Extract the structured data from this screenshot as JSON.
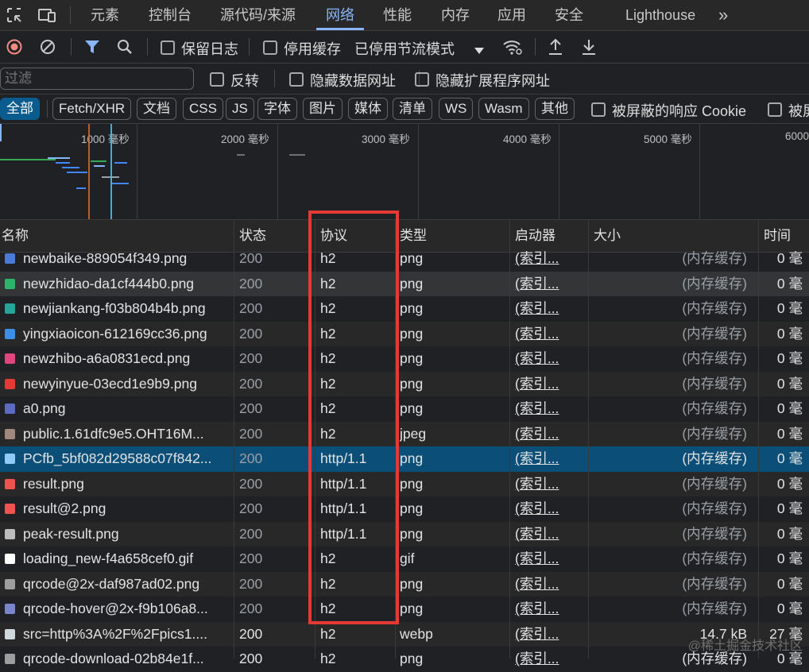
{
  "tabs": [
    "元素",
    "控制台",
    "源代码/来源",
    "网络",
    "性能",
    "内存",
    "应用",
    "安全",
    "Lighthouse"
  ],
  "toolbar": {
    "preserve_log": "保留日志",
    "disable_cache": "停用缓存",
    "throttle": "已停用节流模式"
  },
  "filter": {
    "placeholder": "过滤",
    "invert": "反转",
    "hide_data_urls": "隐藏数据网址",
    "hide_ext_urls": "隐藏扩展程序网址"
  },
  "type_filters": [
    "全部",
    "Fetch/XHR",
    "文档",
    "CSS",
    "JS",
    "字体",
    "图片",
    "媒体",
    "清单",
    "WS",
    "Wasm",
    "其他"
  ],
  "blocked_cookies": "被屏蔽的响应 Cookie",
  "blocked_more": "被屏",
  "overview_labels": [
    "1000 毫秒",
    "2000 毫秒",
    "3000 毫秒",
    "4000 毫秒",
    "5000 毫秒",
    "6000"
  ],
  "columns": [
    "名称",
    "状态",
    "协议",
    "类型",
    "启动器",
    "大小",
    "时间"
  ],
  "rows": [
    {
      "name": "newbaike-889054f349.png",
      "status": "200",
      "protocol": "h2",
      "type": "png",
      "initiator": "(索引...",
      "size": "(内存缓存)",
      "time": "0 毫",
      "icon_color": "#4a7bd8"
    },
    {
      "name": "newzhidao-da1cf444b0.png",
      "status": "200",
      "protocol": "h2",
      "type": "png",
      "initiator": "(索引...",
      "size": "(内存缓存)",
      "time": "0 毫",
      "icon_color": "#2db36b"
    },
    {
      "name": "newjiankang-f03b804b4b.png",
      "status": "200",
      "protocol": "h2",
      "type": "png",
      "initiator": "(索引...",
      "size": "(内存缓存)",
      "time": "0 毫",
      "icon_color": "#25a59a"
    },
    {
      "name": "yingxiaoicon-612169cc36.png",
      "status": "200",
      "protocol": "h2",
      "type": "png",
      "initiator": "(索引...",
      "size": "(内存缓存)",
      "time": "0 毫",
      "icon_color": "#3d8ee6"
    },
    {
      "name": "newzhibo-a6a0831ecd.png",
      "status": "200",
      "protocol": "h2",
      "type": "png",
      "initiator": "(索引...",
      "size": "(内存缓存)",
      "time": "0 毫",
      "icon_color": "#e0457b"
    },
    {
      "name": "newyinyue-03ecd1e9b9.png",
      "status": "200",
      "protocol": "h2",
      "type": "png",
      "initiator": "(索引...",
      "size": "(内存缓存)",
      "time": "0 毫",
      "icon_color": "#e53935"
    },
    {
      "name": "a0.png",
      "status": "200",
      "protocol": "h2",
      "type": "png",
      "initiator": "(索引...",
      "size": "(内存缓存)",
      "time": "0 毫",
      "icon_color": "#5c6bc0"
    },
    {
      "name": "public.1.61dfc9e5.OHT16M...",
      "status": "200",
      "protocol": "h2",
      "type": "jpeg",
      "initiator": "(索引...",
      "size": "(内存缓存)",
      "time": "0 毫",
      "icon_color": "#a1887f"
    },
    {
      "name": "PCfb_5bf082d29588c07f842...",
      "status": "200",
      "protocol": "http/1.1",
      "type": "png",
      "initiator": "(索引...",
      "size": "(内存缓存)",
      "time": "0 毫",
      "icon_color": "#90caf9"
    },
    {
      "name": "result.png",
      "status": "200",
      "protocol": "http/1.1",
      "type": "png",
      "initiator": "(索引...",
      "size": "(内存缓存)",
      "time": "0 毫",
      "icon_color": "#ef5350"
    },
    {
      "name": "result@2.png",
      "status": "200",
      "protocol": "http/1.1",
      "type": "png",
      "initiator": "(索引...",
      "size": "(内存缓存)",
      "time": "0 毫",
      "icon_color": "#ef5350"
    },
    {
      "name": "peak-result.png",
      "status": "200",
      "protocol": "http/1.1",
      "type": "png",
      "initiator": "(索引...",
      "size": "(内存缓存)",
      "time": "0 毫",
      "icon_color": "#bdbdbd"
    },
    {
      "name": "loading_new-f4a658cef0.gif",
      "status": "200",
      "protocol": "h2",
      "type": "gif",
      "initiator": "(索引...",
      "size": "(内存缓存)",
      "time": "0 毫",
      "icon_color": "#ffffff"
    },
    {
      "name": "qrcode@2x-daf987ad02.png",
      "status": "200",
      "protocol": "h2",
      "type": "png",
      "initiator": "(索引...",
      "size": "(内存缓存)",
      "time": "0 毫",
      "icon_color": "#9e9e9e"
    },
    {
      "name": "qrcode-hover@2x-f9b106a8...",
      "status": "200",
      "protocol": "h2",
      "type": "png",
      "initiator": "(索引...",
      "size": "(内存缓存)",
      "time": "0 毫",
      "icon_color": "#7986cb"
    },
    {
      "name": "src=http%3A%2F%2Fpics1....",
      "status": "200",
      "protocol": "h2",
      "type": "webp",
      "initiator": "(索引...",
      "size": "14.7 kB",
      "time": "27 毫",
      "icon_color": "#cfd8dc"
    },
    {
      "name": "qrcode-download-02b84e1f...",
      "status": "200",
      "protocol": "h2",
      "type": "png",
      "initiator": "(索引...",
      "size": "(内存缓存)",
      "time": "0 毫",
      "icon_color": "#9e9e9e"
    }
  ],
  "watermark": "@稀土掘金技术社区"
}
